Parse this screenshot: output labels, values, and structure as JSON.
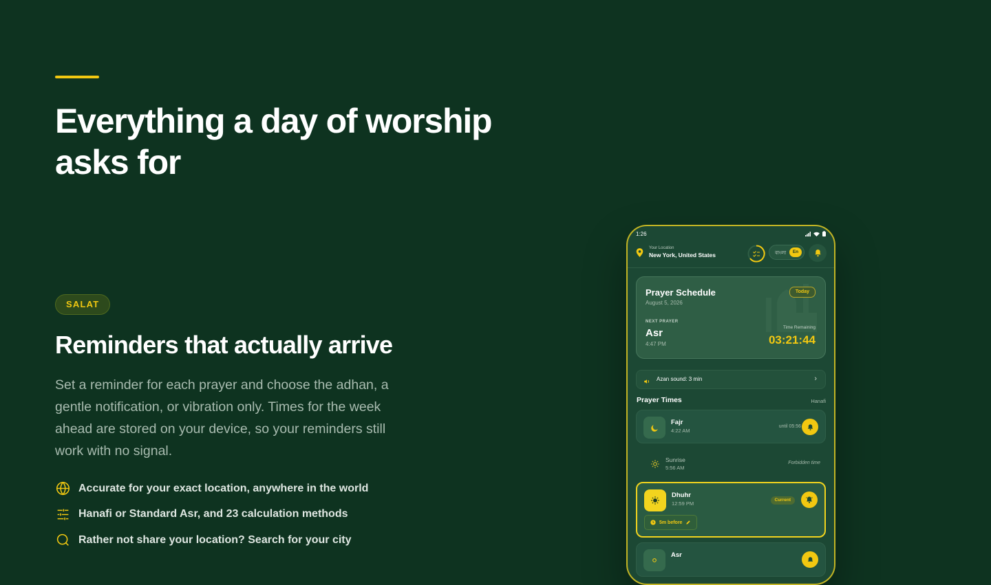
{
  "hero": {
    "headline_line1": "Everything a day of worship",
    "headline_line2": "asks for"
  },
  "section": {
    "badge": "SALAT",
    "title": "Reminders that actually arrive",
    "description": "Set a reminder for each prayer and choose the adhan, a gentle notification, or vibration only. Times for the week ahead are stored on your device, so your reminders still work with no signal."
  },
  "features": [
    {
      "icon": "globe-icon",
      "text": "Accurate for your exact location, anywhere in the world"
    },
    {
      "icon": "sliders-icon",
      "text": "Hanafi or Standard Asr, and 23 calculation methods"
    },
    {
      "icon": "search-icon",
      "text": "Rather not share your location? Search for your city"
    }
  ],
  "colors": {
    "background": "#0e3320",
    "accent": "#f2c811",
    "card": "#2f5e45"
  },
  "phone": {
    "status_time": "1:26",
    "location_label": "Your Location",
    "location_value": "New York, United States",
    "lang_bn": "বাংলা",
    "lang_en": "En",
    "schedule": {
      "title": "Prayer Schedule",
      "date": "August 5, 2026",
      "today": "Today",
      "next_label": "NEXT PRAYER",
      "next_name": "Asr",
      "next_time": "4:47 PM",
      "remaining_label": "Time Remaining",
      "remaining_value": "03:21:44"
    },
    "azan": "Azan sound: 3 min",
    "prayer_times_title": "Prayer Times",
    "method": "Hanafi",
    "prayers": [
      {
        "name": "Fajr",
        "time": "4:22 AM",
        "note": "until 05:56",
        "icon": "moon-icon"
      },
      {
        "name": "Sunrise",
        "time": "5:56 AM",
        "note": "Forbidden time",
        "icon": "sun-icon"
      },
      {
        "name": "Dhuhr",
        "time": "12:59 PM",
        "badge": "Current",
        "reminder": "5m before",
        "icon": "sun-icon"
      },
      {
        "name": "Asr",
        "icon": "bell-icon"
      }
    ]
  }
}
